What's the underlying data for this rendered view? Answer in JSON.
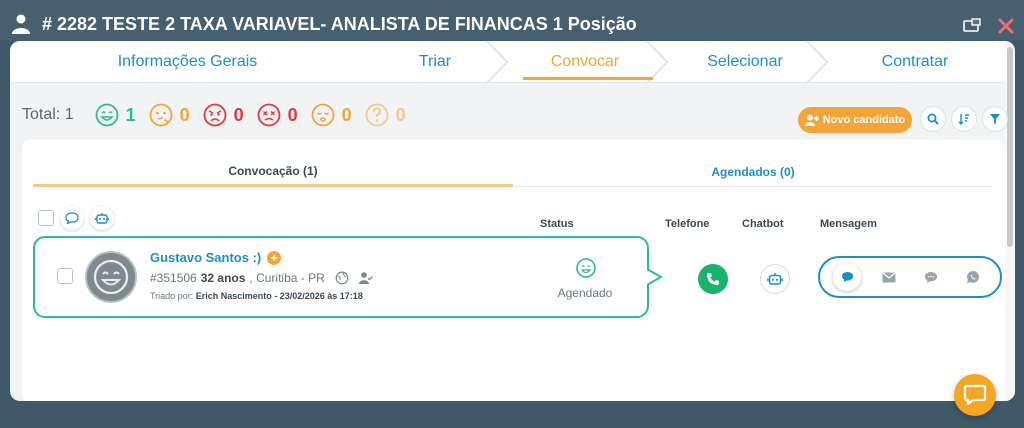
{
  "modal": {
    "title": "# 2282 TESTE 2 TAXA VARIAVEL- ANALISTA DE FINANCAS 1 Posição"
  },
  "steps": [
    {
      "label": "Informações Gerais",
      "active": false
    },
    {
      "label": "Triar",
      "active": false
    },
    {
      "label": "Convocar",
      "active": true
    },
    {
      "label": "Selecionar",
      "active": false
    },
    {
      "label": "Contratar",
      "active": false
    }
  ],
  "totals": {
    "label": "Total: 1",
    "items": [
      {
        "icon": "happy-face-icon",
        "count": "1",
        "color": "#2bbd8d"
      },
      {
        "icon": "thinking-face-icon",
        "count": "0",
        "color": "#f3a53a"
      },
      {
        "icon": "angry-face-icon",
        "count": "0",
        "color": "#e03a3a"
      },
      {
        "icon": "dizzy-face-icon",
        "count": "0",
        "color": "#e03a3a"
      },
      {
        "icon": "sleepy-face-icon",
        "count": "0",
        "color": "#f3a53a"
      },
      {
        "icon": "question-face-icon",
        "count": "0",
        "color": "#f3c98c"
      }
    ]
  },
  "actions": {
    "novo_candidato": "Novo candidato"
  },
  "tabs": {
    "convocacao": "Convocação (1)",
    "agendados": "Agendados (0)"
  },
  "columns": {
    "status": "Status",
    "telefone": "Telefone",
    "chatbot": "Chatbot",
    "mensagem": "Mensagem"
  },
  "candidate": {
    "name": "Gustavo Santos :)",
    "id": "#351506",
    "age": "32 anos",
    "location": ", Curitiba - PR",
    "triado_label": "Triado por:",
    "triado_by": "Erich Nascimento - 23/02/2026 às 17:18",
    "status": "Agendado"
  },
  "colors": {
    "accent_orange": "#f3a53a",
    "link_blue": "#1d8fc6",
    "success_green": "#2bbd8d",
    "phone_green": "#19b36b"
  }
}
